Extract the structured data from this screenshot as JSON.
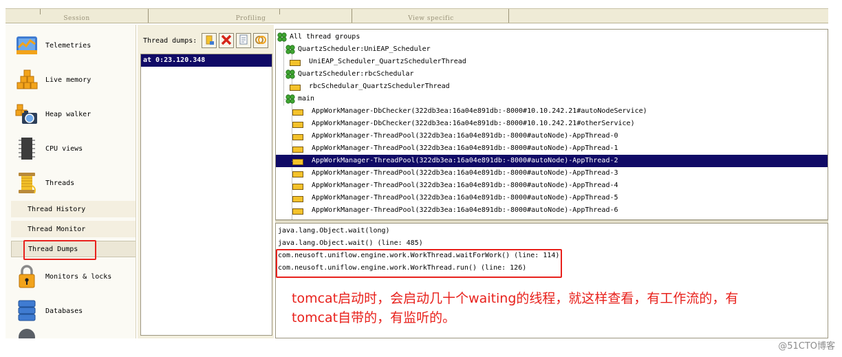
{
  "toolbar": {
    "sections": [
      "Session",
      "Profiling",
      "View specific"
    ]
  },
  "sidebar": {
    "items": [
      {
        "label": "Telemetries",
        "icon": "telemetries-icon"
      },
      {
        "label": "Live memory",
        "icon": "live-memory-icon"
      },
      {
        "label": "Heap walker",
        "icon": "heap-walker-icon"
      },
      {
        "label": "CPU views",
        "icon": "cpu-views-icon"
      },
      {
        "label": "Threads",
        "icon": "threads-icon"
      },
      {
        "label": "Monitors & locks",
        "icon": "lock-icon"
      },
      {
        "label": "Databases",
        "icon": "databases-icon"
      }
    ],
    "thread_subitems": [
      "Thread History",
      "Thread Monitor",
      "Thread Dumps"
    ],
    "selected_subitem": "Thread Dumps"
  },
  "dumps": {
    "header": "Thread dumps:",
    "toolbar_icons": [
      "take-dump-icon",
      "delete-icon",
      "copy-icon",
      "compare-icon"
    ],
    "items": [
      "at 0:23.120.348"
    ],
    "selected": "at 0:23.120.348"
  },
  "tree": {
    "rows": [
      {
        "label": "All thread groups",
        "type": "group"
      },
      {
        "label": "QuartzScheduler:UniEAP_Scheduler",
        "type": "group"
      },
      {
        "label": "UniEAP_Scheduler_QuartzSchedulerThread",
        "type": "thread"
      },
      {
        "label": "QuartzScheduler:rbcSchedular",
        "type": "group"
      },
      {
        "label": "rbcSchedular_QuartzSchedulerThread",
        "type": "thread"
      },
      {
        "label": "main",
        "type": "group"
      },
      {
        "label": "AppWorkManager-DbChecker(322db3ea:16a04e891db:-8000#10.10.242.21#autoNodeService)",
        "type": "thread"
      },
      {
        "label": "AppWorkManager-DbChecker(322db3ea:16a04e891db:-8000#10.10.242.21#otherService)",
        "type": "thread"
      },
      {
        "label": "AppWorkManager-ThreadPool(322db3ea:16a04e891db:-8000#autoNode)-AppThread-0",
        "type": "thread"
      },
      {
        "label": "AppWorkManager-ThreadPool(322db3ea:16a04e891db:-8000#autoNode)-AppThread-1",
        "type": "thread"
      },
      {
        "label": "AppWorkManager-ThreadPool(322db3ea:16a04e891db:-8000#autoNode)-AppThread-2",
        "type": "thread"
      },
      {
        "label": "AppWorkManager-ThreadPool(322db3ea:16a04e891db:-8000#autoNode)-AppThread-3",
        "type": "thread"
      },
      {
        "label": "AppWorkManager-ThreadPool(322db3ea:16a04e891db:-8000#autoNode)-AppThread-4",
        "type": "thread"
      },
      {
        "label": "AppWorkManager-ThreadPool(322db3ea:16a04e891db:-8000#autoNode)-AppThread-5",
        "type": "thread"
      },
      {
        "label": "AppWorkManager-ThreadPool(322db3ea:16a04e891db:-8000#autoNode)-AppThread-6",
        "type": "thread"
      }
    ],
    "selected_label": "AppWorkManager-ThreadPool(322db3ea:16a04e891db:-8000#autoNode)-AppThread-2"
  },
  "stack": {
    "lines": [
      "java.lang.Object.wait(long)",
      "java.lang.Object.wait() (line: 485)",
      "com.neusoft.uniflow.engine.work.WorkThread.waitForWork() (line: 114)",
      "com.neusoft.uniflow.engine.work.WorkThread.run() (line: 126)"
    ]
  },
  "annotation": {
    "line1": "tomcat启动时，会启动几十个waiting的线程，就这样查看，有工作流的，有",
    "line2": "tomcat自带的，有监听的。",
    "color": "#e8211c"
  },
  "credit": "@51CTO博客",
  "colors": {
    "selection": "#100a66",
    "annotation_red": "#e8211c",
    "panel_bg": "#f3efde"
  }
}
